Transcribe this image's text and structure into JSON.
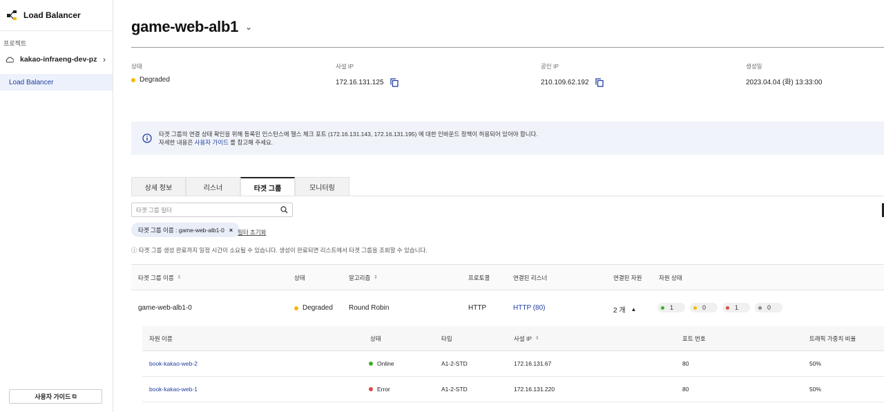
{
  "sidebar": {
    "brand": "Load Balancer",
    "section_label": "프로젝트",
    "project_name": "kakao-infraeng-dev-pz",
    "active_item": "Load Balancer",
    "guide_button": "사용자 가이드"
  },
  "header": {
    "title": "game-web-alb1"
  },
  "summary": {
    "status_label": "상태",
    "status_value": "Degraded",
    "private_ip_label": "사설 IP",
    "private_ip_value": "172.16.131.125",
    "public_ip_label": "공인 IP",
    "public_ip_value": "210.109.62.192",
    "created_label": "생성일",
    "created_value": "2023.04.04 (화) 13:33:00"
  },
  "info": {
    "line1": "타겟 그룹의 연결 상태 확인을 위해 등록된 인스턴스에 헬스 체크 포트 (172.16.131.143, 172.16.131.195) 에 대한 인바운드 정책이 허용되어 있어야 합니다.",
    "line2_prefix": "자세한 내용은",
    "line2_link": "사용자 가이드",
    "line2_suffix": "를 참고해 주세요."
  },
  "tabs": [
    "상세 정보",
    "리스너",
    "타겟 그룹",
    "모니터링"
  ],
  "filter": {
    "placeholder": "타겟 그룹 필터",
    "chip": "타겟 그룹 이름 : game-web-alb1-0",
    "reset": "필터 초기화"
  },
  "notice": "ⓘ 타겟 그룹 생성 완료까지 일정 시간이 소요될 수 있습니다. 생성이 완료되면 리스트에서 타겟 그룹을 조회할 수 있습니다.",
  "table": {
    "headers": [
      "타겟 그룹 이름",
      "상태",
      "알고리즘",
      "프로토콜",
      "연결된 리스너",
      "연결된 자원",
      "자원 상태"
    ],
    "row": {
      "name": "game-web-alb1-0",
      "status": "Degraded",
      "algorithm": "Round Robin",
      "protocol": "HTTP",
      "listener": "HTTP (80)",
      "resources": "2 개",
      "resource_status": [
        {
          "color": "#3fae29",
          "count": "1"
        },
        {
          "color": "#f5b800",
          "count": "0"
        },
        {
          "color": "#e04848",
          "count": "1"
        },
        {
          "color": "#888888",
          "count": "0"
        }
      ]
    }
  },
  "subtable": {
    "headers": [
      "자원 이름",
      "상태",
      "타입",
      "사설 IP",
      "포트 번호",
      "트래픽 가중치 비율"
    ],
    "rows": [
      {
        "name": "book-kakao-web-2",
        "status": "Online",
        "status_color": "#3fae29",
        "type": "A1-2-STD",
        "ip": "172.16.131.67",
        "port": "80",
        "weight": "50%"
      },
      {
        "name": "book-kakao-web-1",
        "status": "Error",
        "status_color": "#e04848",
        "type": "A1-2-STD",
        "ip": "172.16.131.220",
        "port": "80",
        "weight": "50%"
      }
    ]
  },
  "colors": {
    "accent": "#1e3fa0",
    "degraded": "#f5b800"
  }
}
